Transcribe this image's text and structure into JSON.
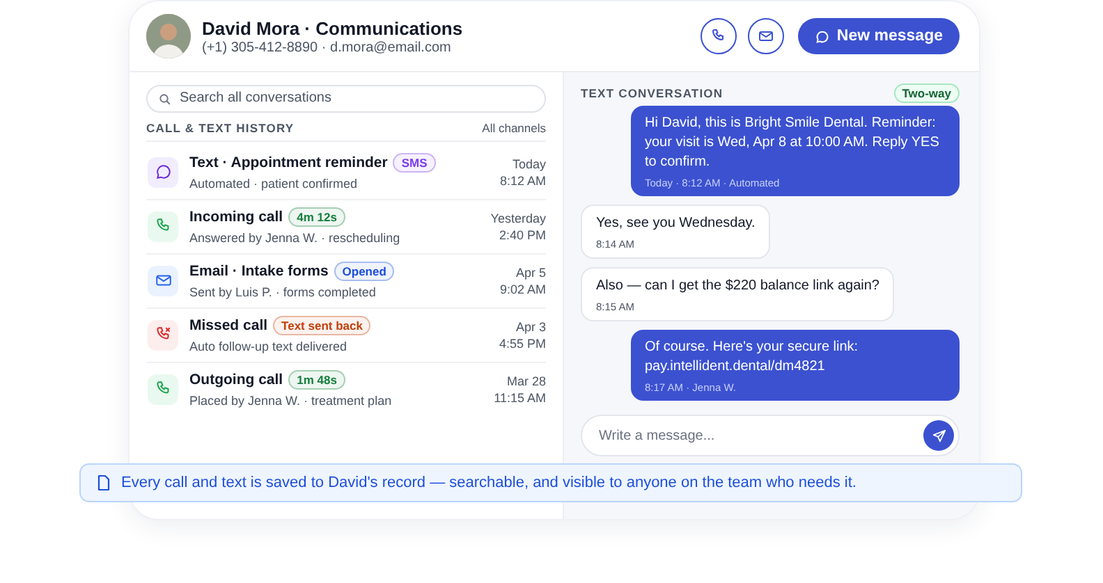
{
  "header": {
    "title": "David Mora · Communications",
    "subtitle": "(+1) 305-412-8890 · d.mora@email.com",
    "new_message_button": "New message"
  },
  "history": {
    "search": {
      "placeholder": "Search all conversations"
    },
    "heading": "CALL & TEXT HISTORY",
    "filter": "All channels",
    "items": [
      {
        "kind": "text",
        "title": "Text · Appointment reminder",
        "badge": "SMS",
        "color": "#7c3aed",
        "detail": "Automated · patient confirmed",
        "date": "Today",
        "time": "8:12 AM"
      },
      {
        "kind": "call",
        "title": "Incoming call",
        "badge": "4m 12s",
        "color": "#15803d",
        "detail": "Answered by Jenna W. · rescheduling",
        "date": "Yesterday",
        "time": "2:40 PM"
      },
      {
        "kind": "email",
        "title": "Email · Intake forms",
        "badge": "Opened",
        "color": "#1d4ed8",
        "detail": "Sent by Luis P. · forms completed",
        "date": "Apr 5",
        "time": "9:02 AM"
      },
      {
        "kind": "missed",
        "title": "Missed call",
        "badge": "Text sent back",
        "color": "#c2410c",
        "detail": "Auto follow-up text delivered",
        "date": "Apr 3",
        "time": "4:55 PM"
      },
      {
        "kind": "call",
        "title": "Outgoing call",
        "badge": "1m 48s",
        "color": "#15803d",
        "detail": "Placed by Jenna W. · treatment plan",
        "date": "Mar 28",
        "time": "11:15 AM"
      }
    ]
  },
  "conversation": {
    "heading": "TEXT CONVERSATION",
    "badge": "Two-way",
    "messages": [
      {
        "kind": "outgoing",
        "text": "Hi David, this is Bright Smile Dental. Reminder: your visit is Wed, Apr 8 at 10:00 AM. Reply YES to confirm.",
        "meta": "Today · 8:12 AM · Automated"
      },
      {
        "kind": "incoming",
        "text": "Yes, see you Wednesday.",
        "meta": "8:14 AM"
      },
      {
        "kind": "incoming",
        "text": "Also — can I get the $220 balance link again?",
        "meta": "8:15 AM"
      },
      {
        "kind": "outgoing",
        "text": "Of course. Here's your secure link: pay.intellident.dental/dm4821",
        "meta": "8:17 AM · Jenna W."
      }
    ],
    "composer": {
      "placeholder": "Write a message..."
    }
  },
  "banner": {
    "text": "Every call and text is saved to David's record — searchable, and visible to anyone on the team who needs it."
  }
}
